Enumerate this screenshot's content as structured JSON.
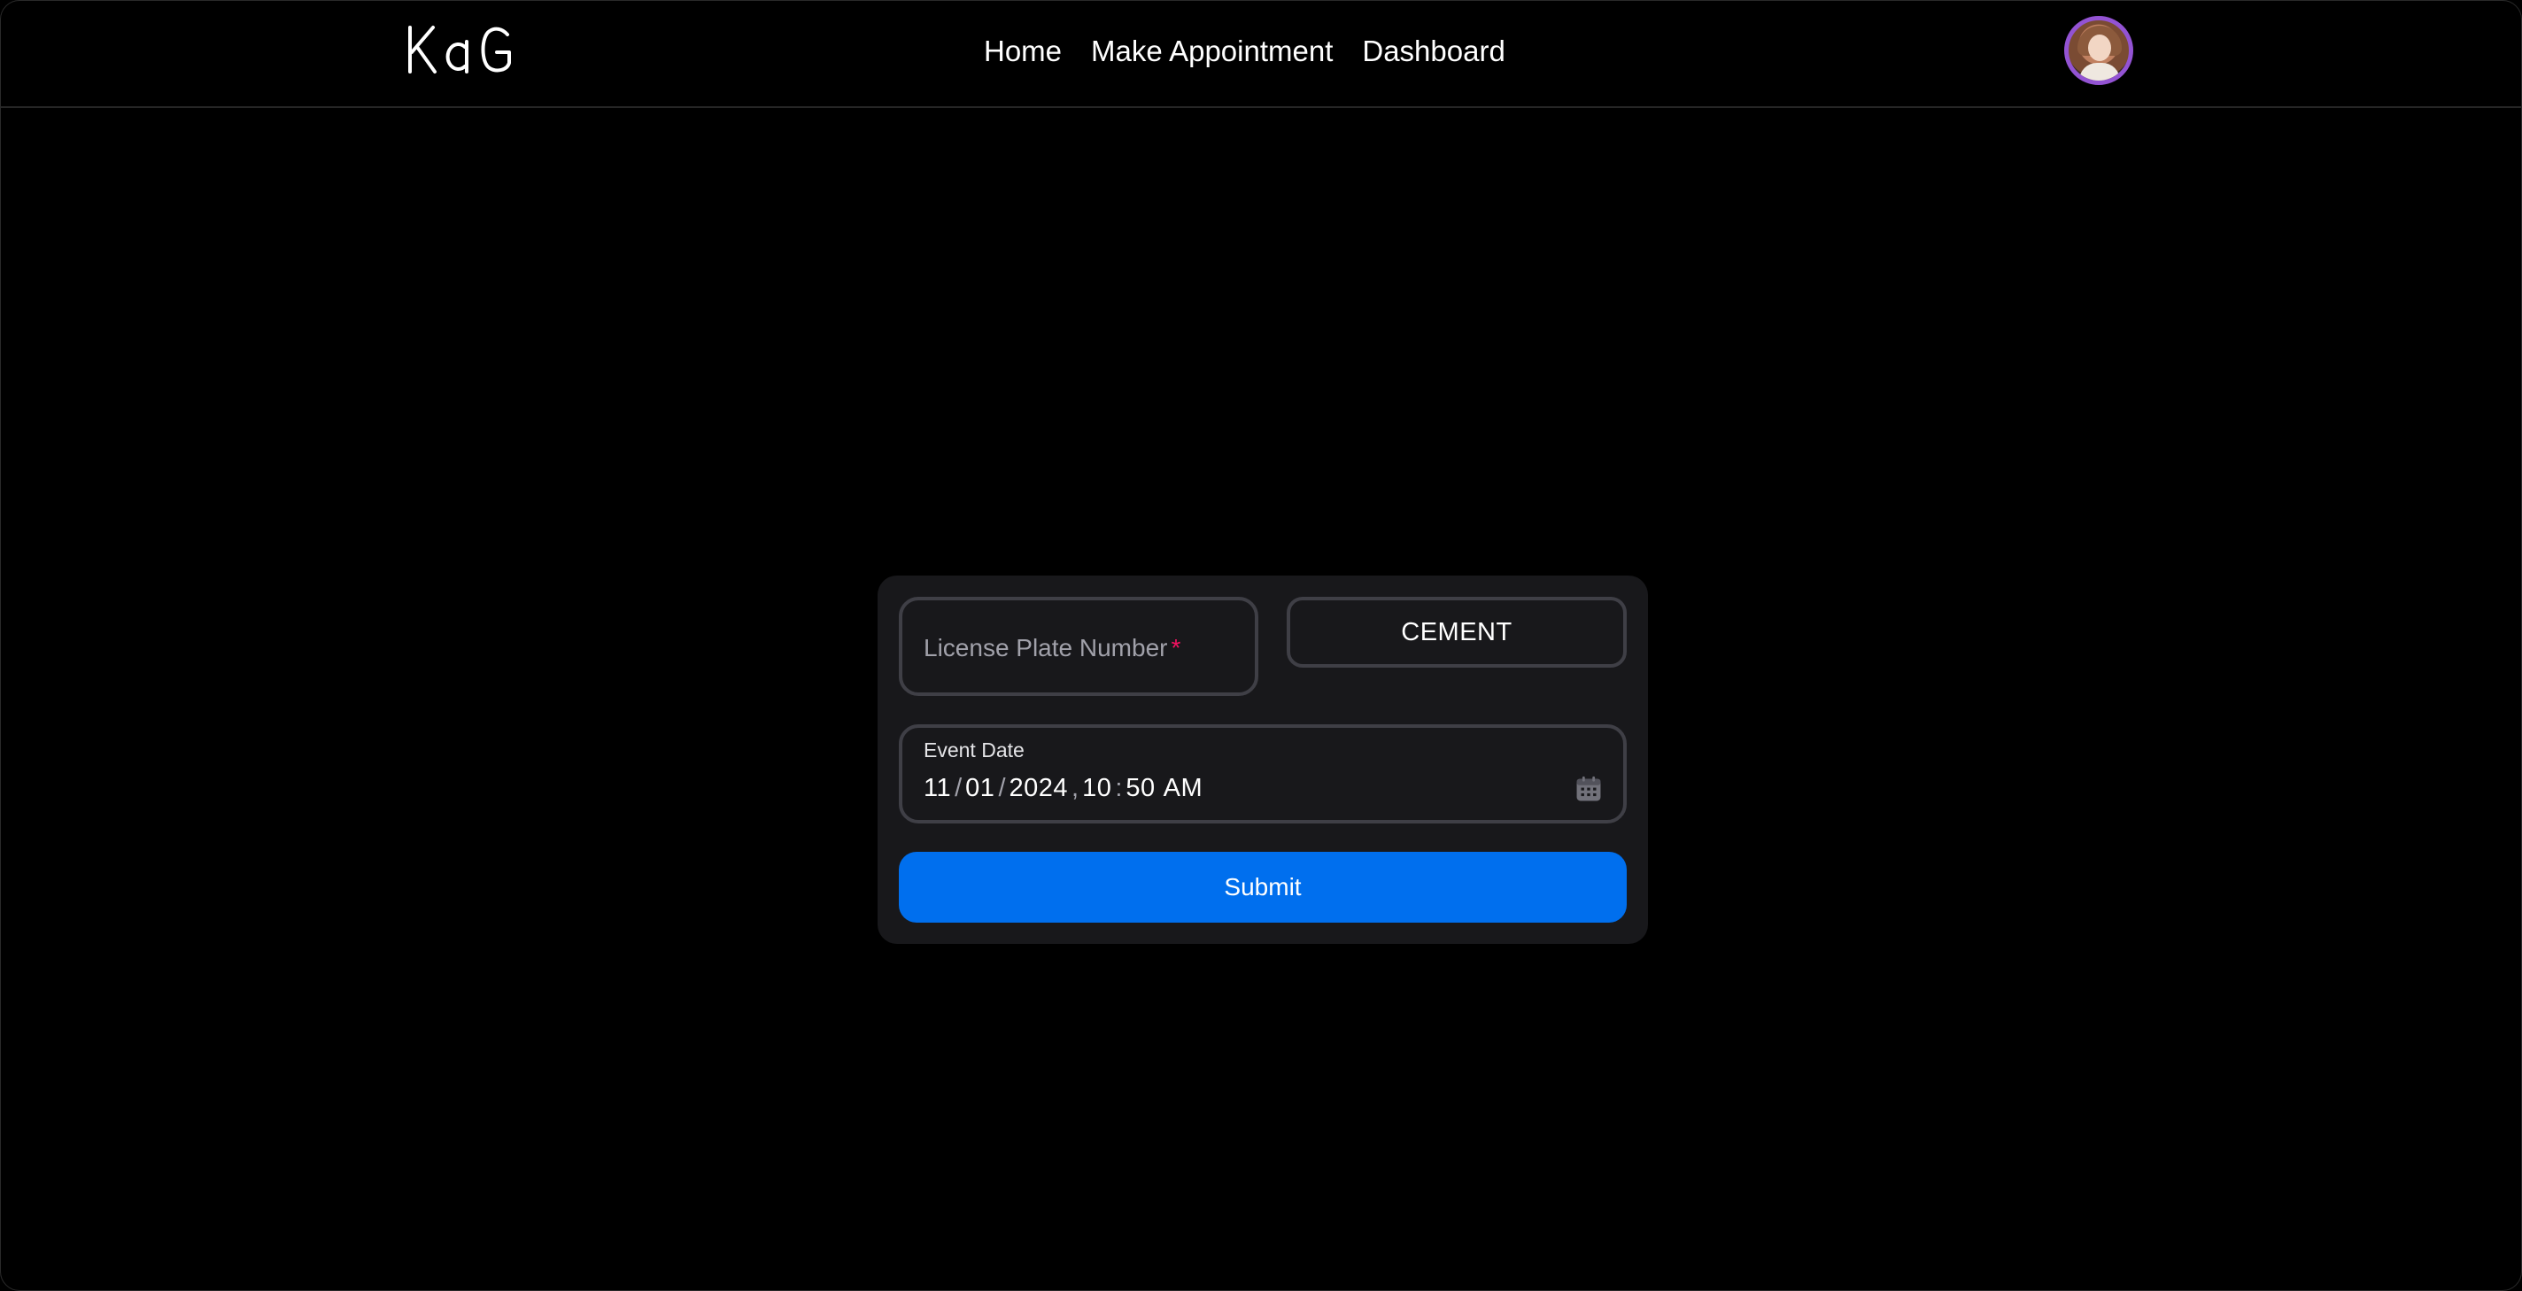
{
  "nav": {
    "logo_text": "KdG",
    "links": [
      {
        "label": "Home"
      },
      {
        "label": "Make Appointment"
      },
      {
        "label": "Dashboard"
      }
    ]
  },
  "form": {
    "license_plate": {
      "label": "License Plate Number",
      "required_marker": "*",
      "value": ""
    },
    "material": {
      "selected": "CEMENT"
    },
    "event_date": {
      "label": "Event Date",
      "month": "11",
      "day": "01",
      "year": "2024",
      "hour": "10",
      "minute": "50",
      "period": "AM",
      "date_sep": "/",
      "datetime_sep": ",",
      "time_sep": ":"
    },
    "submit_label": "Submit"
  },
  "colors": {
    "accent": "#006fee",
    "avatar_ring": "#9353d3",
    "required": "#f31260",
    "card_bg": "#18181b",
    "field_border": "#3f3f46"
  },
  "icons": {
    "calendar": "calendar-icon",
    "avatar": "user-avatar"
  }
}
